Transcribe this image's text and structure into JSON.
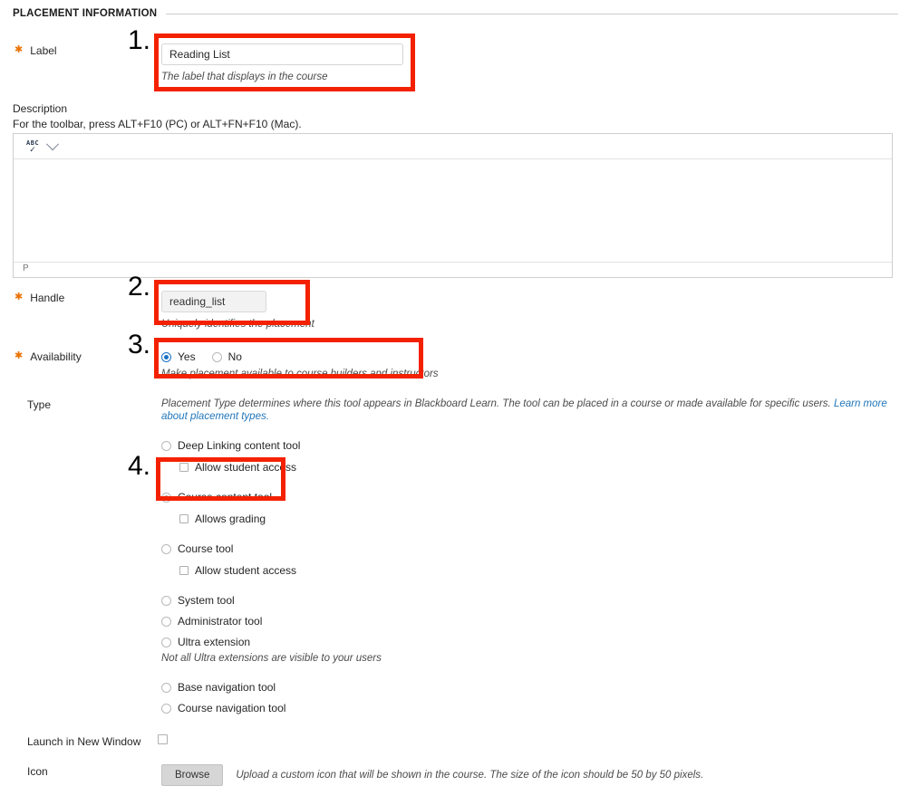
{
  "section": {
    "title": "PLACEMENT INFORMATION"
  },
  "fields": {
    "label": {
      "label": "Label",
      "value": "Reading List",
      "hint": "The label that displays in the course",
      "required": true
    },
    "description": {
      "label": "Description",
      "toolbar_hint": "For the toolbar, press ALT+F10 (PC) or ALT+FN+F10 (Mac).",
      "spellcheck_icon": "abc-checkmark-spellcheck-icon",
      "dropdown_icon": "chevron-down-icon",
      "body_value": "",
      "status_path": "P"
    },
    "handle": {
      "label": "Handle",
      "value": "reading_list",
      "hint": "Uniquely identifies the placement",
      "required": true
    },
    "availability": {
      "label": "Availability",
      "hint": "Make placement available to course builders and instructors",
      "required": true,
      "options": [
        {
          "label": "Yes",
          "selected": true
        },
        {
          "label": "No",
          "selected": false
        }
      ]
    },
    "type": {
      "label": "Type",
      "hint_text": "Placement Type determines where this tool appears in Blackboard Learn. The tool can be placed in a course or made available for specific users.",
      "hint_link": "Learn more about placement types.",
      "link_color": "#2277bb",
      "options": [
        {
          "label": "Deep Linking content tool",
          "selected": false,
          "sub": {
            "label": "Allow student access",
            "checked": false
          }
        },
        {
          "label": "Course content tool",
          "selected": true,
          "sub": {
            "label": "Allows grading",
            "checked": false
          }
        },
        {
          "label": "Course tool",
          "selected": false,
          "sub": {
            "label": "Allow student access",
            "checked": false
          }
        },
        {
          "label": "System tool",
          "selected": false
        },
        {
          "label": "Administrator tool",
          "selected": false
        },
        {
          "label": "Ultra extension",
          "selected": false
        }
      ],
      "ultra_note": "Not all Ultra extensions are visible to your users",
      "nav_options": [
        {
          "label": "Base navigation tool",
          "selected": false
        },
        {
          "label": "Course navigation tool",
          "selected": false
        }
      ]
    },
    "launch_new_window": {
      "label": "Launch in New Window",
      "checked": false
    },
    "icon": {
      "label": "Icon",
      "button_label": "Browse",
      "hint": "Upload a custom icon that will be shown in the course. The size of the icon should be 50 by 50 pixels."
    }
  },
  "annotations": {
    "color": "#f42100",
    "numbers": [
      "1.",
      "2.",
      "3.",
      "4."
    ]
  }
}
